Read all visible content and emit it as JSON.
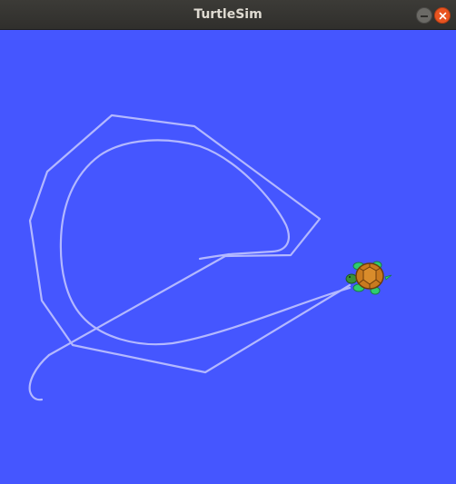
{
  "window": {
    "title": "TurtleSim"
  },
  "colors": {
    "canvas_background": "#4556ff",
    "pen_trail": "#b3b8ff",
    "titlebar": "#3c3b37",
    "close_button": "#e95420"
  },
  "icons": {
    "minimize": "minimize-icon",
    "close": "close-icon",
    "turtle": "turtle-icon"
  }
}
